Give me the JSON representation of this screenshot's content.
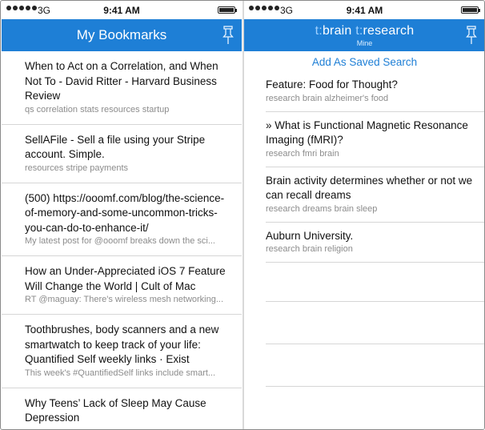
{
  "status_bar": {
    "carrier": "3G",
    "time": "9:41 AM"
  },
  "left_screen": {
    "title": "My Bookmarks",
    "items": [
      {
        "title": "When to Act on a Correlation, and When Not To - David Ritter - Harvard Business Review",
        "subtitle": "qs correlation stats resources startup"
      },
      {
        "title": "SellAFile - Sell a file using your Stripe account. Simple.",
        "subtitle": "resources stripe payments"
      },
      {
        "title": "(500) https://ooomf.com/blog/the-science-of-memory-and-some-uncommon-tricks-you-can-do-to-enhance-it/",
        "subtitle": "My latest post for @ooomf breaks down the sci..."
      },
      {
        "title": "How an Under-Appreciated iOS 7 Feature Will Change the World | Cult of Mac",
        "subtitle": "RT @maguay: There's wireless mesh networking..."
      },
      {
        "title": "Toothbrushes, body scanners and a new smartwatch to keep track of your life: Quantified Self weekly links · Exist",
        "subtitle": "This week's #QuantifiedSelf links include smart..."
      },
      {
        "title": "Why Teens’ Lack of Sleep May Cause Depression",
        "subtitle": ""
      }
    ]
  },
  "right_screen": {
    "title_tag1": "t:",
    "title_word1": "brain",
    "title_tag2": "t:",
    "title_word2": "research",
    "subtitle": "Mine",
    "action": "Add As Saved Search",
    "items": [
      {
        "title": "Feature: Food for Thought?",
        "subtitle": "research brain alzheimer's food"
      },
      {
        "title": "» What is Functional Magnetic Resonance Imaging (fMRI)?",
        "subtitle": "research fmri brain"
      },
      {
        "title": "Brain activity determines whether or not we can recall dreams",
        "subtitle": "research dreams brain sleep"
      },
      {
        "title": "Auburn University.",
        "subtitle": "research brain religion"
      }
    ]
  },
  "icons": {
    "pin": "pin-icon"
  },
  "colors": {
    "nav_blue": "#1e7fd6",
    "tag_light_blue": "#9fd0ff"
  }
}
